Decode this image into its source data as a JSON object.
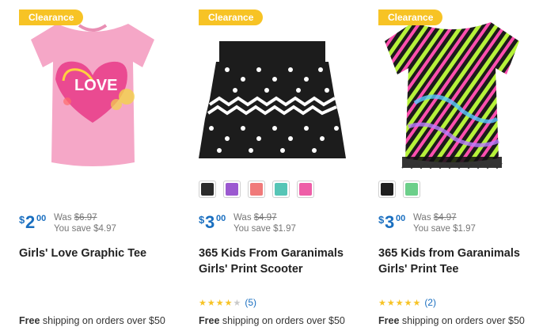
{
  "products": [
    {
      "badge": "Clearance",
      "price": {
        "dollar": "$",
        "whole": "2",
        "cents": "00"
      },
      "was_label": "Was",
      "was_price": "$6.97",
      "save_text": "You save $4.97",
      "title": "Girls' Love Graphic Tee",
      "image_text": "LOVE",
      "ship_bold": "Free",
      "ship_rest": " shipping on orders over $50",
      "swatches": [],
      "rating": null
    },
    {
      "badge": "Clearance",
      "price": {
        "dollar": "$",
        "whole": "3",
        "cents": "00"
      },
      "was_label": "Was",
      "was_price": "$4.97",
      "save_text": "You save $1.97",
      "title_line1": "365 Kids From Garanimals",
      "title_line2": "Girls' Print Scooter",
      "ship_bold": "Free",
      "ship_rest": " shipping on orders over $50",
      "swatches": [
        {
          "color": "#2b2b2b",
          "name": "black-print"
        },
        {
          "color": "#9b59d0",
          "name": "purple"
        },
        {
          "color": "#f07a7a",
          "name": "coral-dots"
        },
        {
          "color": "#56c5b6",
          "name": "teal-dots"
        },
        {
          "color": "#ee5ea7",
          "name": "pink-dots"
        }
      ],
      "rating": {
        "stars": 4,
        "max": 5,
        "count": "(5)"
      }
    },
    {
      "badge": "Clearance",
      "price": {
        "dollar": "$",
        "whole": "3",
        "cents": "00"
      },
      "was_label": "Was",
      "was_price": "$4.97",
      "save_text": "You save $1.97",
      "title_line1": "365 Kids from Garanimals",
      "title_line2": "Girls' Print Tee",
      "ship_bold": "Free",
      "ship_rest": " shipping on orders over $50",
      "swatches": [
        {
          "color": "#1e1e1e",
          "name": "black-zebra"
        },
        {
          "color": "#6ccf8a",
          "name": "green-print"
        }
      ],
      "rating": {
        "stars": 5,
        "max": 5,
        "count": "(2)"
      }
    }
  ],
  "colors": {
    "accent": "#1a6fc0",
    "badge": "#f7c325",
    "star": "#f7c325"
  }
}
